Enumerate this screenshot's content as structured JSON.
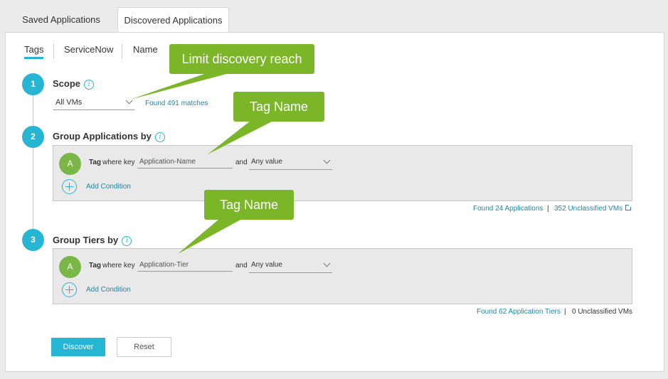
{
  "top_tabs": [
    {
      "label": "Saved Applications",
      "active": false
    },
    {
      "label": "Discovered Applications",
      "active": true
    }
  ],
  "sub_tabs": [
    {
      "label": "Tags",
      "active": true
    },
    {
      "label": "ServiceNow",
      "active": false
    },
    {
      "label": "Name",
      "active": false
    }
  ],
  "steps": {
    "scope": {
      "number": "1",
      "title": "Scope",
      "dropdown_value": "All VMs",
      "matches_link": "Found 491 matches"
    },
    "group_apps": {
      "number": "2",
      "title": "Group Applications by",
      "condition": {
        "avatar": "A",
        "tag_label": "Tag",
        "where_label": "where key",
        "key_value": "Application-Name",
        "and_label": "and",
        "value_dropdown": "Any value"
      },
      "add_condition": "Add Condition",
      "found_link": "Found 24 Applications",
      "separator": "|",
      "unclassified_link": "352 Unclassified VMs"
    },
    "group_tiers": {
      "number": "3",
      "title": "Group Tiers by",
      "condition": {
        "avatar": "A",
        "tag_label": "Tag",
        "where_label": "where key",
        "key_value": "Application-Tier",
        "and_label": "and",
        "value_dropdown": "Any value"
      },
      "add_condition": "Add Condition",
      "found_link": "Found 62 Application Tiers",
      "separator": "|",
      "unclassified_text": "0 Unclassified VMs"
    }
  },
  "buttons": {
    "discover": "Discover",
    "reset": "Reset"
  },
  "info_glyph": "i",
  "callouts": {
    "limit": "Limit discovery reach",
    "tag_name_1": "Tag Name",
    "tag_name_2": "Tag Name"
  },
  "colors": {
    "accent": "#27b5d4",
    "link": "#1f87a8",
    "callout": "#7ab628",
    "avatar": "#7ab648"
  },
  "icons": {
    "info": "info-icon",
    "chevron": "chevron-down-icon",
    "add": "plus-circle-icon",
    "external": "external-link-icon"
  }
}
